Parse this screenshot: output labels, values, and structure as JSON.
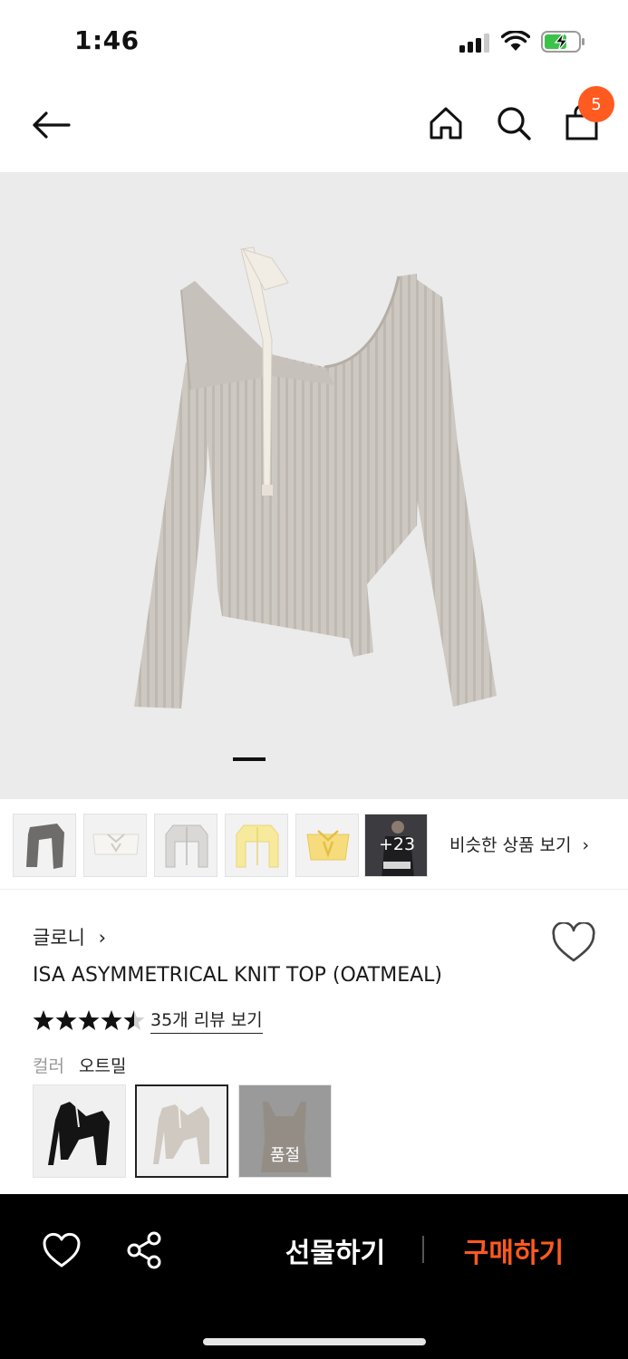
{
  "status_bar": {
    "time": "1:46",
    "battery_color": "#3cc24a",
    "icons": [
      "signal-icon",
      "wifi-icon",
      "battery-charging-icon"
    ]
  },
  "nav": {
    "icons": [
      "back-arrow-icon",
      "home-icon",
      "search-icon",
      "shopping-bag-icon"
    ],
    "cart_count": "5",
    "badge_color": "#ff5a1f"
  },
  "gallery": {
    "image_alt": "oatmeal asymmetrical knit top",
    "page_indicator": "1",
    "thumbnails": [
      {
        "name": "black-knit-top"
      },
      {
        "name": "white-bow-top"
      },
      {
        "name": "grey-cardigan"
      },
      {
        "name": "yellow-cardigan"
      },
      {
        "name": "yellow-bow-top"
      },
      {
        "name": "model-photo",
        "more_label": "+23"
      }
    ],
    "similar_label": "비슷한 상품 보기",
    "similar_chevron": "›"
  },
  "product": {
    "brand": "글로니",
    "brand_chevron": "›",
    "title": "ISA ASYMMETRICAL KNIT TOP (OATMEAL)",
    "rating": 4.5,
    "rating_max": 5,
    "review_link": "35개 리뷰 보기",
    "color_label": "컬러",
    "color_value": "오트밀",
    "swatches": [
      {
        "name": "black",
        "selected": false,
        "sold_out": false
      },
      {
        "name": "oatmeal",
        "selected": true,
        "sold_out": false
      },
      {
        "name": "beige",
        "selected": false,
        "sold_out": true,
        "sold_out_label": "품절"
      }
    ]
  },
  "bottom_bar": {
    "gift_label": "선물하기",
    "buy_label": "구매하기",
    "accent_color": "#ff5a1f",
    "icons": [
      "heart-icon",
      "share-icon"
    ]
  }
}
